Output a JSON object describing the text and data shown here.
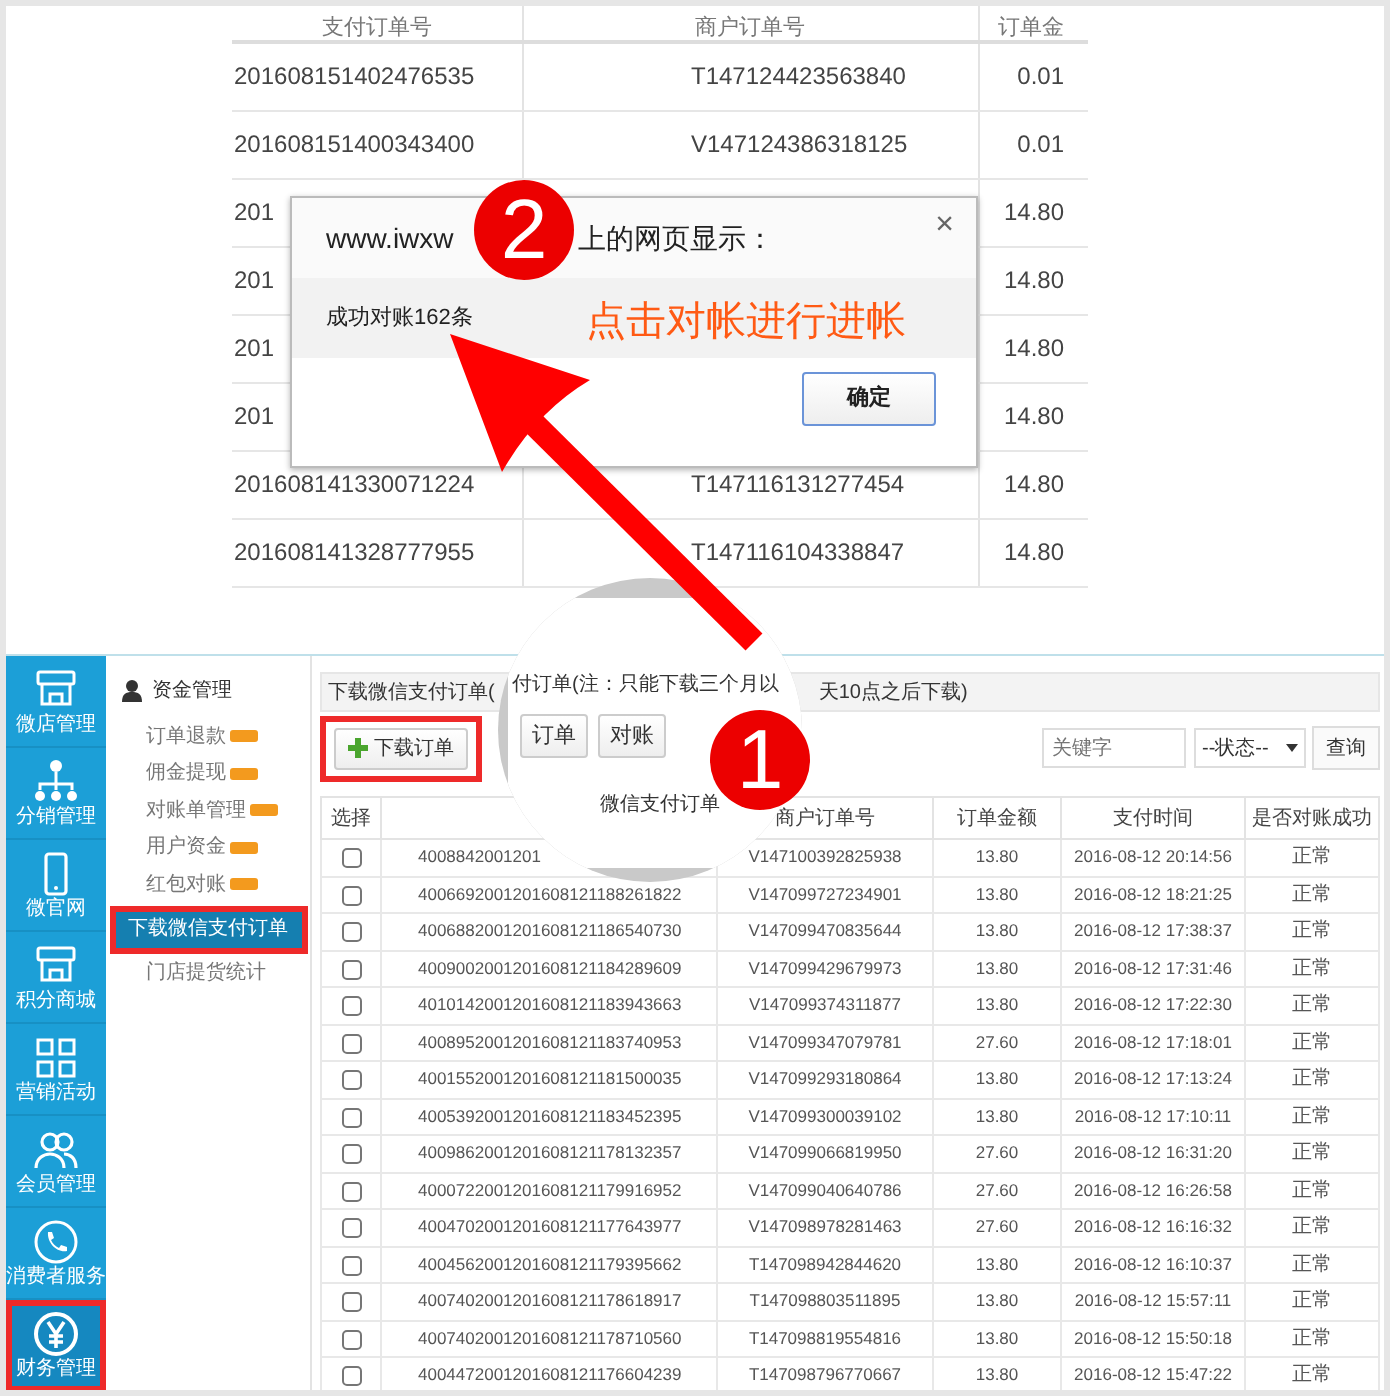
{
  "background_table": {
    "columns": [
      "支付订单号",
      "商户订单号",
      "订单金"
    ],
    "rows": [
      [
        "201608151402476535",
        "T147124423563840",
        "0.01"
      ],
      [
        "201608151400343400",
        "V147124386318125",
        "0.01"
      ],
      [
        "201",
        "",
        "14.80"
      ],
      [
        "201",
        "",
        "14.80"
      ],
      [
        "201",
        "",
        "14.80"
      ],
      [
        "201",
        "",
        "14.80"
      ],
      [
        "201608141330071224",
        "T147116131277454",
        "14.80"
      ],
      [
        "201608141328777955",
        "T147116104338847",
        "14.80"
      ]
    ]
  },
  "dialog": {
    "title_parts": [
      "www.iwxw",
      "上的网页显示："
    ],
    "close": "×",
    "message": "成功对账162条",
    "button": "确定"
  },
  "annotations": {
    "callout": "点击对帐进行进帐",
    "steps": [
      {
        "number": "2"
      },
      {
        "number": "1"
      }
    ]
  },
  "magnifier": {
    "note": "付订单(注：只能下载三个月以",
    "buttons": [
      "订单",
      "对账"
    ],
    "column": "微信支付订单"
  },
  "nav": [
    {
      "label": "微店管理",
      "kind": "shop",
      "selected": false
    },
    {
      "label": "分销管理",
      "kind": "tree",
      "selected": false
    },
    {
      "label": "微官网",
      "kind": "phone",
      "selected": false
    },
    {
      "label": "积分商城",
      "kind": "shop",
      "selected": false
    },
    {
      "label": "营销活动",
      "kind": "grid",
      "selected": false
    },
    {
      "label": "会员管理",
      "kind": "people",
      "selected": false
    },
    {
      "label": "消费者服务",
      "kind": "handset",
      "selected": false
    },
    {
      "label": "财务管理",
      "kind": "yen",
      "selected": true
    }
  ],
  "submenu": {
    "title": "资金管理",
    "items": [
      {
        "label": "订单退款",
        "new": true,
        "selected": false
      },
      {
        "label": "佣金提现",
        "new": true,
        "selected": false
      },
      {
        "label": "对账单管理",
        "new": true,
        "selected": false
      },
      {
        "label": "用户资金",
        "new": true,
        "selected": false
      },
      {
        "label": "红包对账",
        "new": true,
        "selected": false
      },
      {
        "label": "下载微信支付订单",
        "new": false,
        "selected": true
      },
      {
        "label": "门店提货统计",
        "new": false,
        "selected": false
      }
    ]
  },
  "page_note": [
    "下载微信支付订单(",
    "天10点之后下载)"
  ],
  "toolbar": {
    "download_button": "下载订单",
    "highlighted": true,
    "search": {
      "placeholder": "关键字"
    },
    "status_select": "--状态--",
    "query_button": "查询"
  },
  "orders": {
    "columns": [
      "选择",
      "商户订单号",
      "订单金额",
      "支付时间",
      "是否对账成功"
    ],
    "rows": [
      {
        "checked": false,
        "wechat_order": "4008842001201",
        "merchant_order": "V147100392825938",
        "amount": "13.80",
        "paid_at": "2016-08-12 20:14:56",
        "status": "正常"
      },
      {
        "checked": false,
        "wechat_order": "4006692001201608121188261822",
        "merchant_order": "V147099727234901",
        "amount": "13.80",
        "paid_at": "2016-08-12 18:21:25",
        "status": "正常"
      },
      {
        "checked": false,
        "wechat_order": "4006882001201608121186540730",
        "merchant_order": "V147099470835644",
        "amount": "13.80",
        "paid_at": "2016-08-12 17:38:37",
        "status": "正常"
      },
      {
        "checked": false,
        "wechat_order": "4009002001201608121184289609",
        "merchant_order": "V147099429679973",
        "amount": "13.80",
        "paid_at": "2016-08-12 17:31:46",
        "status": "正常"
      },
      {
        "checked": false,
        "wechat_order": "4010142001201608121183943663",
        "merchant_order": "V147099374311877",
        "amount": "13.80",
        "paid_at": "2016-08-12 17:22:30",
        "status": "正常"
      },
      {
        "checked": false,
        "wechat_order": "4008952001201608121183740953",
        "merchant_order": "V147099347079781",
        "amount": "27.60",
        "paid_at": "2016-08-12 17:18:01",
        "status": "正常"
      },
      {
        "checked": false,
        "wechat_order": "4001552001201608121181500035",
        "merchant_order": "V147099293180864",
        "amount": "13.80",
        "paid_at": "2016-08-12 17:13:24",
        "status": "正常"
      },
      {
        "checked": false,
        "wechat_order": "4005392001201608121183452395",
        "merchant_order": "V147099300039102",
        "amount": "13.80",
        "paid_at": "2016-08-12 17:10:11",
        "status": "正常"
      },
      {
        "checked": false,
        "wechat_order": "4009862001201608121178132357",
        "merchant_order": "V147099066819950",
        "amount": "27.60",
        "paid_at": "2016-08-12 16:31:20",
        "status": "正常"
      },
      {
        "checked": false,
        "wechat_order": "4000722001201608121179916952",
        "merchant_order": "V147099040640786",
        "amount": "27.60",
        "paid_at": "2016-08-12 16:26:58",
        "status": "正常"
      },
      {
        "checked": false,
        "wechat_order": "4004702001201608121177643977",
        "merchant_order": "V147098978281463",
        "amount": "27.60",
        "paid_at": "2016-08-12 16:16:32",
        "status": "正常"
      },
      {
        "checked": false,
        "wechat_order": "4004562001201608121179395662",
        "merchant_order": "T147098942844620",
        "amount": "13.80",
        "paid_at": "2016-08-12 16:10:37",
        "status": "正常"
      },
      {
        "checked": false,
        "wechat_order": "4007402001201608121178618917",
        "merchant_order": "T147098803511895",
        "amount": "13.80",
        "paid_at": "2016-08-12 15:57:11",
        "status": "正常"
      },
      {
        "checked": false,
        "wechat_order": "4007402001201608121178710560",
        "merchant_order": "T147098819554816",
        "amount": "13.80",
        "paid_at": "2016-08-12 15:50:18",
        "status": "正常"
      },
      {
        "checked": false,
        "wechat_order": "4004472001201608121176604239",
        "merchant_order": "T147098796770667",
        "amount": "13.80",
        "paid_at": "2016-08-12 15:47:22",
        "status": "正常"
      }
    ]
  }
}
